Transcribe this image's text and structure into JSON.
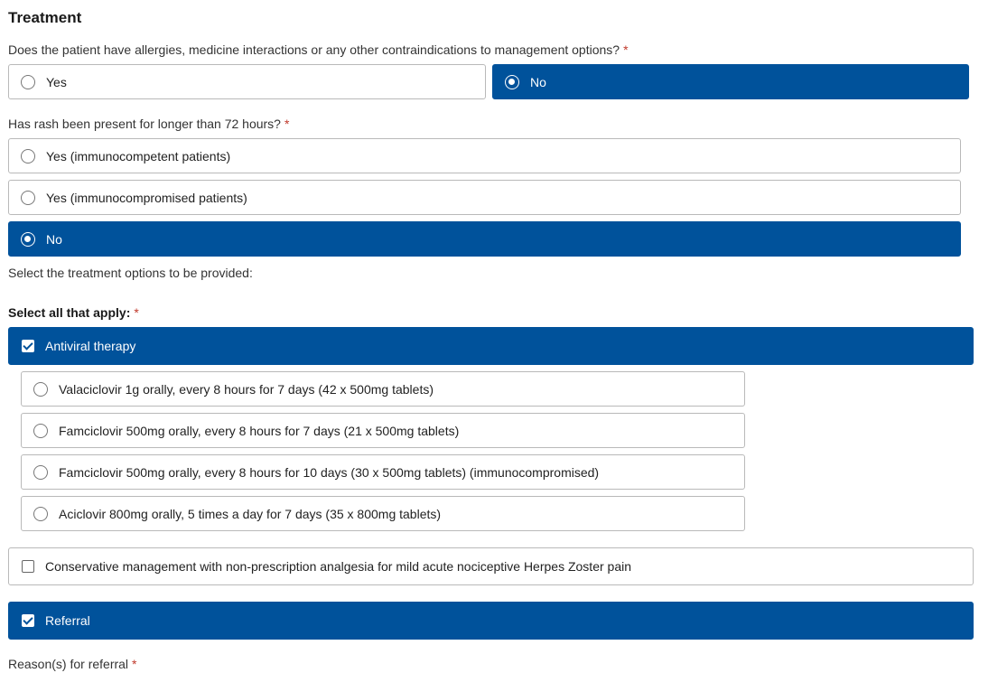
{
  "title": "Treatment",
  "q_allergies": {
    "label": "Does the patient have allergies, medicine interactions or any other contraindications to management options?",
    "required": "*",
    "options": [
      {
        "label": "Yes",
        "selected": false
      },
      {
        "label": "No",
        "selected": true
      }
    ]
  },
  "q_rash": {
    "label": "Has rash been present for longer than 72 hours?",
    "required": "*",
    "options": [
      {
        "label": "Yes (immunocompetent patients)",
        "selected": false
      },
      {
        "label": "Yes (immunocompromised patients)",
        "selected": false
      },
      {
        "label": "No",
        "selected": true
      }
    ]
  },
  "treatment_intro": "Select the treatment options to be provided:",
  "select_all": {
    "label": "Select all that apply:",
    "required": "*"
  },
  "antiviral": {
    "label": "Antiviral therapy",
    "checked": true,
    "options": [
      {
        "label": "Valaciclovir 1g orally, every 8 hours for 7 days (42 x 500mg tablets)",
        "selected": false
      },
      {
        "label": "Famciclovir 500mg orally, every 8 hours for 7 days (21 x 500mg tablets)",
        "selected": false
      },
      {
        "label": "Famciclovir 500mg orally, every 8 hours for 10 days (30 x 500mg tablets) (immunocompromised)",
        "selected": false
      },
      {
        "label": "Aciclovir 800mg orally, 5 times a day for 7 days (35 x 800mg tablets)",
        "selected": false
      }
    ]
  },
  "conservative": {
    "label": "Conservative management with non-prescription analgesia for mild acute nociceptive Herpes Zoster pain",
    "checked": false
  },
  "referral": {
    "label": "Referral",
    "checked": true
  },
  "referral_reason": {
    "label": "Reason(s) for referral",
    "required": "*"
  },
  "colors": {
    "selected_bg": "#00529b",
    "required": "#c0392b"
  }
}
